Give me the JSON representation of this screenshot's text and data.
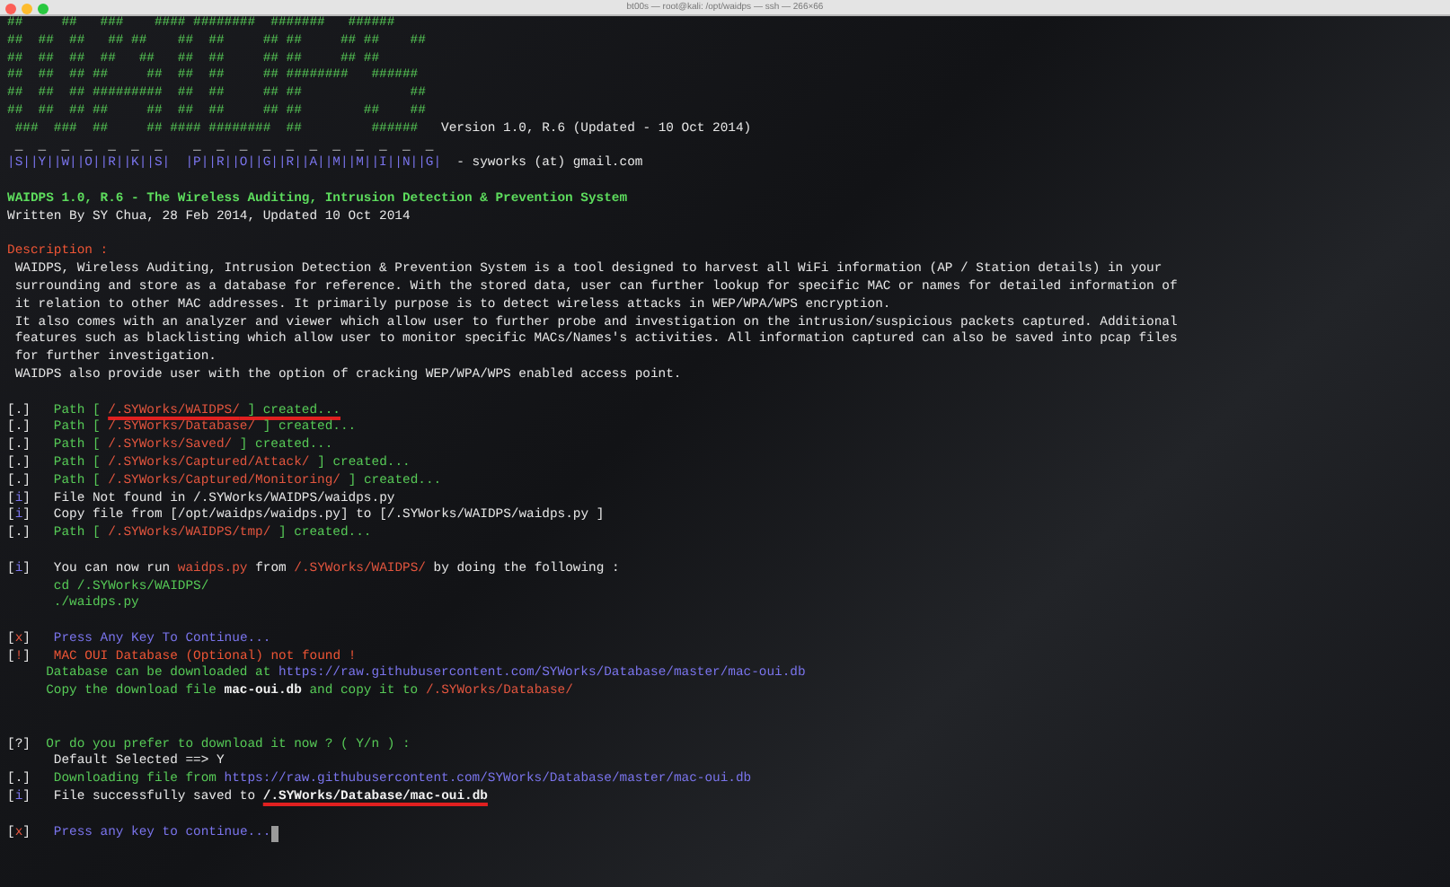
{
  "window": {
    "title": "bt00s — root@kali: /opt/waidps — ssh — 266×66"
  },
  "lines": [
    {
      "kind": "text",
      "segments": [
        {
          "kind": "ok",
          "text": "##     ##   ###    #### ########  #######   ######"
        }
      ]
    },
    {
      "kind": "text",
      "segments": [
        {
          "kind": "ok",
          "text": "##  ##  ##   ## ##    ##  ##     ## ##     ## ##    ##"
        }
      ]
    },
    {
      "kind": "text",
      "segments": [
        {
          "kind": "ok",
          "text": "##  ##  ##  ##   ##   ##  ##     ## ##     ## ##"
        }
      ]
    },
    {
      "kind": "text",
      "segments": [
        {
          "kind": "ok",
          "text": "##  ##  ## ##     ##  ##  ##     ## ########   ######"
        }
      ]
    },
    {
      "kind": "text",
      "segments": [
        {
          "kind": "ok",
          "text": "##  ##  ## #########  ##  ##     ## ##              ##"
        }
      ]
    },
    {
      "kind": "text",
      "segments": [
        {
          "kind": "ok",
          "text": "##  ##  ## ##     ##  ##  ##     ## ##        ##    ##"
        }
      ]
    },
    {
      "kind": "text",
      "segments": [
        {
          "kind": "ok",
          "text": " ###  ###  ##     ## #### ########  ##         ######   "
        },
        {
          "kind": "plain",
          "text": "Version 1.0, R.6 (Updated - 10 Oct 2014)"
        }
      ]
    },
    {
      "kind": "text",
      "segments": [
        {
          "kind": "plain",
          "text": " _  _  _  _  _  _  _    _  _  _  _  _  _  _  _  _  _  _"
        }
      ]
    },
    {
      "kind": "text",
      "segments": [
        {
          "kind": "url",
          "text": "|S||Y||W||O||R||K||S|  |P||R||O||G||R||A||M||M||I||N||G|"
        },
        {
          "kind": "plain",
          "text": "  - syworks (at) gmail.com"
        }
      ]
    },
    {
      "kind": "blank"
    },
    {
      "kind": "text",
      "segments": [
        {
          "kind": "title",
          "text": "WAIDPS 1.0, R.6 - The Wireless Auditing, Intrusion Detection & Prevention System"
        }
      ]
    },
    {
      "kind": "text",
      "segments": [
        {
          "kind": "plain",
          "text": "Written By SY Chua, 28 Feb 2014, Updated 10 Oct 2014"
        }
      ]
    },
    {
      "kind": "blank"
    },
    {
      "kind": "text",
      "segments": [
        {
          "kind": "alert",
          "text": "Description :"
        }
      ]
    },
    {
      "kind": "text",
      "segments": [
        {
          "kind": "plain",
          "text": " WAIDPS, Wireless Auditing, Intrusion Detection & Prevention System is a tool designed to harvest all WiFi information (AP / Station details) in your"
        }
      ]
    },
    {
      "kind": "text",
      "segments": [
        {
          "kind": "plain",
          "text": " surrounding and store as a database for reference. With the stored data, user can further lookup for specific MAC or names for detailed information of"
        }
      ]
    },
    {
      "kind": "text",
      "segments": [
        {
          "kind": "plain",
          "text": " it relation to other MAC addresses. It primarily purpose is to detect wireless attacks in WEP/WPA/WPS encryption."
        }
      ]
    },
    {
      "kind": "text",
      "segments": [
        {
          "kind": "plain",
          "text": " It also comes with an analyzer and viewer which allow user to further probe and investigation on the intrusion/suspicious packets captured. Additional"
        }
      ]
    },
    {
      "kind": "text",
      "segments": [
        {
          "kind": "plain",
          "text": " features such as blacklisting which allow user to monitor specific MACs/Names's activities. All information captured can also be saved into pcap files"
        }
      ]
    },
    {
      "kind": "text",
      "segments": [
        {
          "kind": "plain",
          "text": " for further investigation."
        }
      ]
    },
    {
      "kind": "text",
      "segments": [
        {
          "kind": "plain",
          "text": " WAIDPS also provide user with the option of cracking WEP/WPA/WPS enabled access point."
        }
      ]
    },
    {
      "kind": "blank"
    },
    {
      "kind": "text",
      "segments": [
        {
          "kind": "plain",
          "text": "[.]   "
        },
        {
          "kind": "ok",
          "text": "Path [ "
        },
        {
          "kind": "path",
          "text": "/.SYWorks/WAIDPS/",
          "underline": true
        },
        {
          "kind": "ok",
          "text": " ] created...",
          "underline": true
        }
      ]
    },
    {
      "kind": "text",
      "segments": [
        {
          "kind": "plain",
          "text": "[.]   "
        },
        {
          "kind": "ok",
          "text": "Path [ "
        },
        {
          "kind": "path",
          "text": "/.SYWorks/Database/"
        },
        {
          "kind": "ok",
          "text": " ] created..."
        }
      ]
    },
    {
      "kind": "text",
      "segments": [
        {
          "kind": "plain",
          "text": "[.]   "
        },
        {
          "kind": "ok",
          "text": "Path [ "
        },
        {
          "kind": "path",
          "text": "/.SYWorks/Saved/"
        },
        {
          "kind": "ok",
          "text": " ] created..."
        }
      ]
    },
    {
      "kind": "text",
      "segments": [
        {
          "kind": "plain",
          "text": "[.]   "
        },
        {
          "kind": "ok",
          "text": "Path [ "
        },
        {
          "kind": "path",
          "text": "/.SYWorks/Captured/Attack/"
        },
        {
          "kind": "ok",
          "text": " ] created..."
        }
      ]
    },
    {
      "kind": "text",
      "segments": [
        {
          "kind": "plain",
          "text": "[.]   "
        },
        {
          "kind": "ok",
          "text": "Path [ "
        },
        {
          "kind": "path",
          "text": "/.SYWorks/Captured/Monitoring/"
        },
        {
          "kind": "ok",
          "text": " ] created..."
        }
      ]
    },
    {
      "kind": "text",
      "segments": [
        {
          "kind": "plain",
          "text": "["
        },
        {
          "kind": "url",
          "text": "i"
        },
        {
          "kind": "plain",
          "text": "]   File Not found in /.SYWorks/WAIDPS/waidps.py"
        }
      ]
    },
    {
      "kind": "text",
      "segments": [
        {
          "kind": "plain",
          "text": "["
        },
        {
          "kind": "url",
          "text": "i"
        },
        {
          "kind": "plain",
          "text": "]   Copy file from [/opt/waidps/waidps.py] to [/.SYWorks/WAIDPS/waidps.py ]"
        }
      ]
    },
    {
      "kind": "text",
      "segments": [
        {
          "kind": "plain",
          "text": "[.]   "
        },
        {
          "kind": "ok",
          "text": "Path [ "
        },
        {
          "kind": "path",
          "text": "/.SYWorks/WAIDPS/tmp/"
        },
        {
          "kind": "ok",
          "text": " ] created..."
        }
      ]
    },
    {
      "kind": "blank"
    },
    {
      "kind": "text",
      "segments": [
        {
          "kind": "plain",
          "text": "["
        },
        {
          "kind": "url",
          "text": "i"
        },
        {
          "kind": "plain",
          "text": "]   You can now run "
        },
        {
          "kind": "path",
          "text": "waidps.py"
        },
        {
          "kind": "plain",
          "text": " from "
        },
        {
          "kind": "path",
          "text": "/.SYWorks/WAIDPS/"
        },
        {
          "kind": "plain",
          "text": " by doing the following :"
        }
      ]
    },
    {
      "kind": "text",
      "segments": [
        {
          "kind": "ok",
          "text": "      cd /.SYWorks/WAIDPS/"
        }
      ]
    },
    {
      "kind": "text",
      "segments": [
        {
          "kind": "ok",
          "text": "      ./waidps.py"
        }
      ]
    },
    {
      "kind": "blank"
    },
    {
      "kind": "text",
      "segments": [
        {
          "kind": "plain",
          "text": "["
        },
        {
          "kind": "path",
          "text": "x"
        },
        {
          "kind": "plain",
          "text": "]   "
        },
        {
          "kind": "url",
          "text": "Press Any Key To Continue..."
        }
      ]
    },
    {
      "kind": "text",
      "segments": [
        {
          "kind": "plain",
          "text": "["
        },
        {
          "kind": "path",
          "text": "!"
        },
        {
          "kind": "plain",
          "text": "]   "
        },
        {
          "kind": "alert",
          "text": "MAC OUI Database (Optional) not found !"
        }
      ]
    },
    {
      "kind": "text",
      "segments": [
        {
          "kind": "ok",
          "text": "     Database can be downloaded at "
        },
        {
          "kind": "url",
          "text": "https://raw.githubusercontent.com/SYWorks/Database/master/mac-oui.db"
        }
      ]
    },
    {
      "kind": "text",
      "segments": [
        {
          "kind": "ok",
          "text": "     Copy the download file "
        },
        {
          "kind": "bold",
          "text": "mac-oui.db"
        },
        {
          "kind": "ok",
          "text": " and copy it to "
        },
        {
          "kind": "path",
          "text": "/.SYWorks/Database/"
        }
      ]
    },
    {
      "kind": "blank"
    },
    {
      "kind": "blank"
    },
    {
      "kind": "text",
      "segments": [
        {
          "kind": "plain",
          "text": "[?]  "
        },
        {
          "kind": "ok",
          "text": "Or do you prefer to download it now ? ( Y/n ) :"
        }
      ]
    },
    {
      "kind": "text",
      "segments": [
        {
          "kind": "plain",
          "text": "      Default Selected ==> Y"
        }
      ]
    },
    {
      "kind": "text",
      "segments": [
        {
          "kind": "plain",
          "text": "[.]   "
        },
        {
          "kind": "ok",
          "text": "Downloading file from "
        },
        {
          "kind": "url",
          "text": "https://raw.githubusercontent.com/SYWorks/Database/master/mac-oui.db"
        }
      ]
    },
    {
      "kind": "text",
      "segments": [
        {
          "kind": "plain",
          "text": "["
        },
        {
          "kind": "url",
          "text": "i"
        },
        {
          "kind": "plain",
          "text": "]   File successfully saved to "
        },
        {
          "kind": "bold",
          "text": "/.SYWorks/Database/mac-oui.db",
          "underline": true
        }
      ]
    },
    {
      "kind": "blank"
    },
    {
      "kind": "text",
      "cursor": true,
      "segments": [
        {
          "kind": "plain",
          "text": "["
        },
        {
          "kind": "path",
          "text": "x"
        },
        {
          "kind": "plain",
          "text": "]   "
        },
        {
          "kind": "url",
          "text": "Press any key to continue..."
        }
      ]
    }
  ]
}
